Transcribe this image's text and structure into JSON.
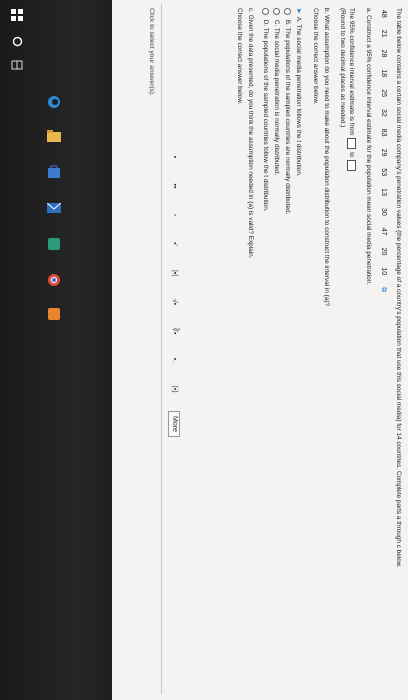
{
  "problem": {
    "intro": "The table below contains a certain social media company's penetration values (the percentage of a country's population that use this social media) for 14 countries. Complete parts a through c below.",
    "data_values": [
      "48",
      "21",
      "28",
      "18",
      "25",
      "32",
      "83",
      "29",
      "53",
      "13",
      "30",
      "47",
      "20",
      "10"
    ],
    "part_a": "a. Construct a 95% confidence interval estimate for the population mean social media penetration.",
    "interval_prefix": "The 95% confidence interval estimate is from",
    "interval_to": "to",
    "round_note": "(Round to two decimal places as needed.)",
    "part_b": "b. What assumption do you need to make about the population distribution to construct the interval in (a)?",
    "choose_b": "Choose the correct answer below.",
    "options": [
      {
        "letter": "A.",
        "text": "The social media penetration follows the t distribution.",
        "selected": true
      },
      {
        "letter": "B.",
        "text": "The populations of the sampled countries are normally distributed.",
        "selected": false
      },
      {
        "letter": "C.",
        "text": "The social media penetration is normally distributed.",
        "selected": false
      },
      {
        "letter": "D.",
        "text": "The populations of the sampled countries follow the t distribution.",
        "selected": false
      }
    ],
    "part_c": "c. Given the data presented, do you think the assumption needed in (a) is valid? Explain.",
    "choose_c": "Choose the correct answer below."
  },
  "toolbar": {
    "items": [
      "▪",
      "▪▪",
      "▫",
      "▪'",
      "|▪|",
      "√▪",
      "∛▪",
      "▪.",
      "(▪)"
    ],
    "more_label": "More"
  },
  "footer": {
    "click_select": "Click to select your answer(s)."
  },
  "taskbar": {
    "icons": [
      "windows-logo",
      "search",
      "task-view",
      "edge",
      "file-explorer",
      "store",
      "mail",
      "app",
      "chrome",
      "app2"
    ],
    "colors": {
      "edge": "#2a8bd6",
      "explorer": "#e8b64a",
      "store": "#3b7bd0",
      "chrome": "#e04b3a"
    }
  }
}
